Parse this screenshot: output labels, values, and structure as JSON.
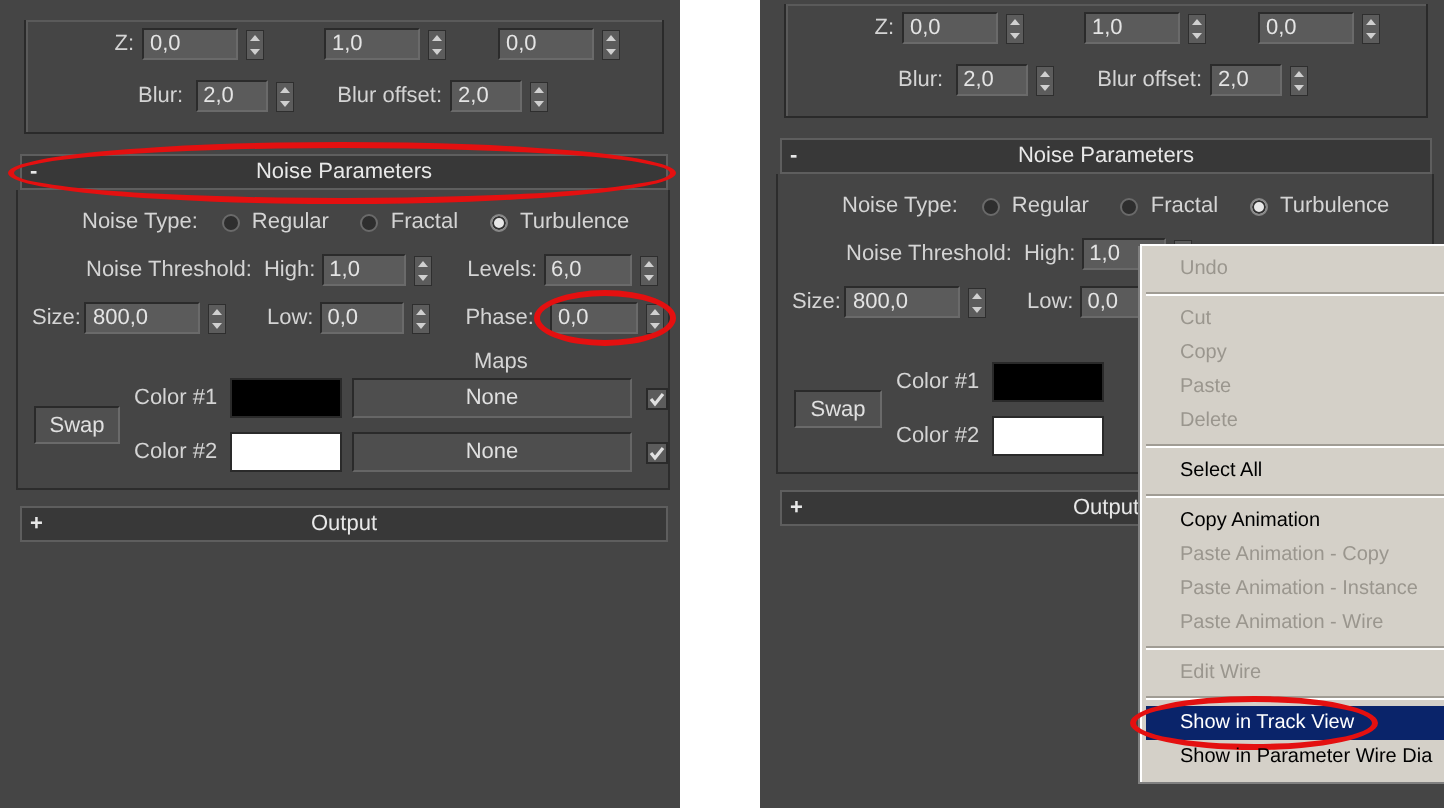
{
  "panels": [
    {
      "coord_rows": [
        {
          "label": "Z:",
          "values": [
            "0,0",
            "1,0",
            "0,0"
          ]
        }
      ],
      "blur": {
        "label": "Blur:",
        "value": "2,0"
      },
      "blur_offset": {
        "label": "Blur offset:",
        "value": "2,0"
      },
      "noise_rollout": {
        "toggle": "-",
        "title": "Noise Parameters",
        "highlighted": true,
        "noise_type": {
          "label": "Noise Type:",
          "options": [
            {
              "label": "Regular",
              "selected": false
            },
            {
              "label": "Fractal",
              "selected": false
            },
            {
              "label": "Turbulence",
              "selected": true
            }
          ]
        },
        "threshold_label": "Noise Threshold:",
        "high": {
          "label": "High:",
          "value": "1,0"
        },
        "levels": {
          "label": "Levels:",
          "value": "6,0"
        },
        "size": {
          "label": "Size:",
          "value": "800,0"
        },
        "low": {
          "label": "Low:",
          "value": "0,0"
        },
        "phase": {
          "label": "Phase:",
          "value": "0,0",
          "highlighted": true
        },
        "maps_label": "Maps",
        "swap_button": "Swap",
        "colors": [
          {
            "label": "Color #1",
            "color": "#000000",
            "map": "None",
            "checked": true
          },
          {
            "label": "Color #2",
            "color": "#ffffff",
            "map": "None",
            "checked": true
          }
        ]
      },
      "output_rollout": {
        "toggle": "+",
        "title": "Output"
      }
    },
    {
      "coord_rows": [
        {
          "label": "Z:",
          "values": [
            "0,0",
            "1,0",
            "0,0"
          ]
        }
      ],
      "blur": {
        "label": "Blur:",
        "value": "2,0"
      },
      "blur_offset": {
        "label": "Blur offset:",
        "value": "2,0"
      },
      "noise_rollout": {
        "toggle": "-",
        "title": "Noise Parameters",
        "highlighted": false,
        "noise_type": {
          "label": "Noise Type:",
          "options": [
            {
              "label": "Regular",
              "selected": false
            },
            {
              "label": "Fractal",
              "selected": false
            },
            {
              "label": "Turbulence",
              "selected": true
            }
          ]
        },
        "threshold_label": "Noise Threshold:",
        "high": {
          "label": "High:",
          "value": "1,0"
        },
        "size": {
          "label": "Size:",
          "value": "800,0"
        },
        "low": {
          "label": "Low:",
          "value": "0,0"
        },
        "swap_button": "Swap",
        "colors": [
          {
            "label": "Color #1",
            "color": "#000000"
          },
          {
            "label": "Color #2",
            "color": "#ffffff"
          }
        ]
      },
      "output_rollout": {
        "toggle": "+",
        "title": "Output"
      },
      "context_menu": {
        "items": [
          {
            "kind": "item",
            "label": "Undo",
            "disabled": true,
            "selected": false,
            "highlighted": false
          },
          {
            "kind": "separator"
          },
          {
            "kind": "item",
            "label": "Cut",
            "disabled": true,
            "selected": false,
            "highlighted": false
          },
          {
            "kind": "item",
            "label": "Copy",
            "disabled": true,
            "selected": false,
            "highlighted": false
          },
          {
            "kind": "item",
            "label": "Paste",
            "disabled": true,
            "selected": false,
            "highlighted": false
          },
          {
            "kind": "item",
            "label": "Delete",
            "disabled": true,
            "selected": false,
            "highlighted": false
          },
          {
            "kind": "separator"
          },
          {
            "kind": "item",
            "label": "Select All",
            "disabled": false,
            "selected": false,
            "highlighted": false
          },
          {
            "kind": "separator"
          },
          {
            "kind": "item",
            "label": "Copy Animation",
            "disabled": false,
            "selected": false,
            "highlighted": false
          },
          {
            "kind": "item",
            "label": "Paste Animation - Copy",
            "disabled": true,
            "selected": false,
            "highlighted": false
          },
          {
            "kind": "item",
            "label": "Paste Animation - Instance",
            "disabled": true,
            "selected": false,
            "highlighted": false
          },
          {
            "kind": "item",
            "label": "Paste Animation - Wire",
            "disabled": true,
            "selected": false,
            "highlighted": false
          },
          {
            "kind": "separator"
          },
          {
            "kind": "item",
            "label": "Edit Wire",
            "disabled": true,
            "selected": false,
            "highlighted": false
          },
          {
            "kind": "separator"
          },
          {
            "kind": "item",
            "label": "Show in Track View",
            "disabled": false,
            "selected": true,
            "highlighted": true
          },
          {
            "kind": "item",
            "label": "Show in Parameter Wire Dia",
            "disabled": false,
            "selected": false,
            "highlighted": false
          }
        ]
      }
    }
  ]
}
